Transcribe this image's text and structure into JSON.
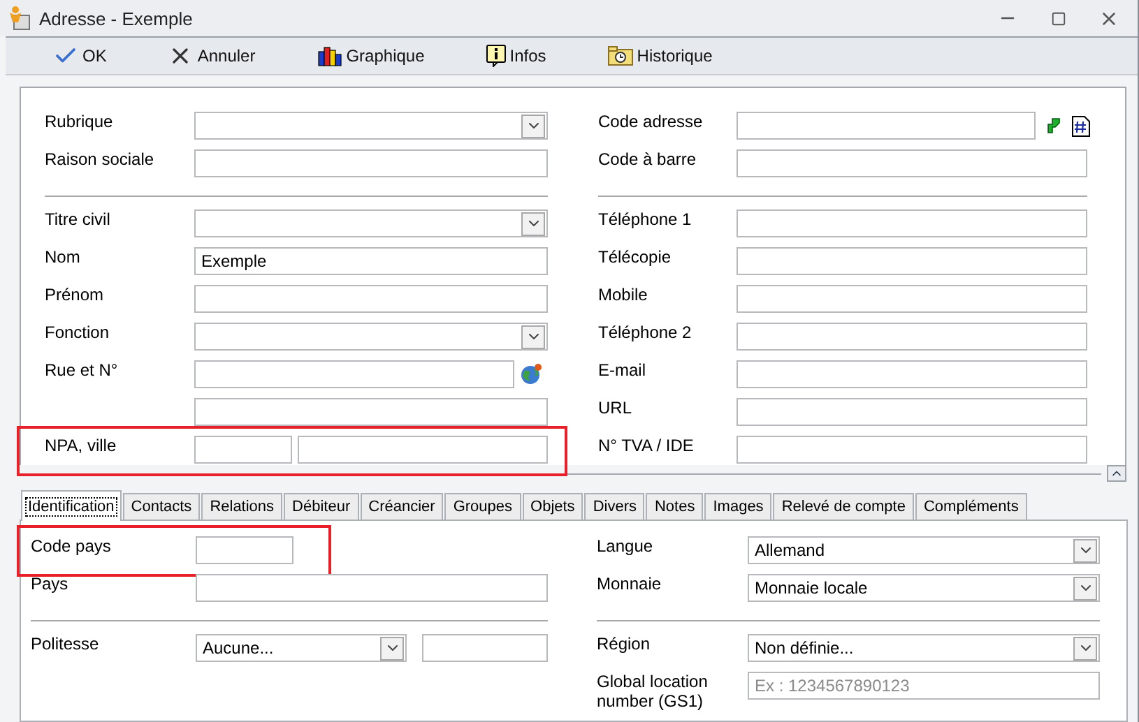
{
  "window": {
    "title": "Adresse - Exemple"
  },
  "toolbar": [
    {
      "kind": "ok",
      "label": "OK"
    },
    {
      "kind": "cancel",
      "label": "Annuler"
    },
    {
      "kind": "chart",
      "label": "Graphique"
    },
    {
      "kind": "info",
      "label": "Infos"
    },
    {
      "kind": "history",
      "label": "Historique"
    }
  ],
  "form": {
    "left": [
      [
        {
          "label": "Rubrique",
          "kind": "select"
        },
        {
          "label": "Raison sociale",
          "kind": "text"
        }
      ],
      [
        {
          "label": "Titre civil",
          "kind": "select"
        },
        {
          "label": "Nom",
          "kind": "text",
          "value": "Exemple"
        },
        {
          "label": "Prénom",
          "kind": "text"
        },
        {
          "label": "Fonction",
          "kind": "select"
        },
        {
          "label": "Rue et N°",
          "kind": "globe"
        },
        {
          "kind": "text"
        },
        {
          "label": "NPA, ville",
          "kind": "split",
          "highlighted": true
        }
      ]
    ],
    "right": [
      [
        {
          "label": "Code adresse",
          "kind": "code"
        },
        {
          "label": "Code à barre",
          "kind": "text"
        }
      ],
      [
        {
          "label": "Téléphone 1",
          "kind": "text"
        },
        {
          "label": "Télécopie",
          "kind": "text"
        },
        {
          "label": "Mobile",
          "kind": "text"
        },
        {
          "label": "Téléphone 2",
          "kind": "text"
        },
        {
          "label": "E-mail",
          "kind": "text"
        },
        {
          "label": "URL",
          "kind": "text"
        },
        {
          "label": "N° TVA / IDE",
          "kind": "text"
        }
      ]
    ]
  },
  "tabs": [
    {
      "label": "Identification",
      "selected": true
    },
    {
      "label": "Contacts",
      "selected": false
    },
    {
      "label": "Relations",
      "selected": false
    },
    {
      "label": "Débiteur",
      "selected": false
    },
    {
      "label": "Créancier",
      "selected": false
    },
    {
      "label": "Groupes",
      "selected": false
    },
    {
      "label": "Objets",
      "selected": false
    },
    {
      "label": "Divers",
      "selected": false
    },
    {
      "label": "Notes",
      "selected": false
    },
    {
      "label": "Images",
      "selected": false
    },
    {
      "label": "Relevé de compte",
      "selected": false
    },
    {
      "label": "Compléments",
      "selected": false
    }
  ],
  "tab_form": {
    "left": [
      [
        {
          "label": "Code pays",
          "kind": "short",
          "highlighted": true
        },
        {
          "label": "Pays",
          "kind": "text"
        }
      ],
      [
        {
          "label": "Politesse",
          "kind": "select-extra",
          "value": "Aucune..."
        }
      ]
    ],
    "right": [
      [
        {
          "label": "Langue",
          "kind": "select",
          "value": "Allemand"
        },
        {
          "label": "Monnaie",
          "kind": "select",
          "value": "Monnaie locale"
        }
      ],
      [
        {
          "label": "Région",
          "kind": "select",
          "value": "Non définie..."
        },
        {
          "label": "Global location number (GS1)",
          "kind": "text",
          "placeholder": "Ex : 1234567890123"
        }
      ]
    ]
  }
}
